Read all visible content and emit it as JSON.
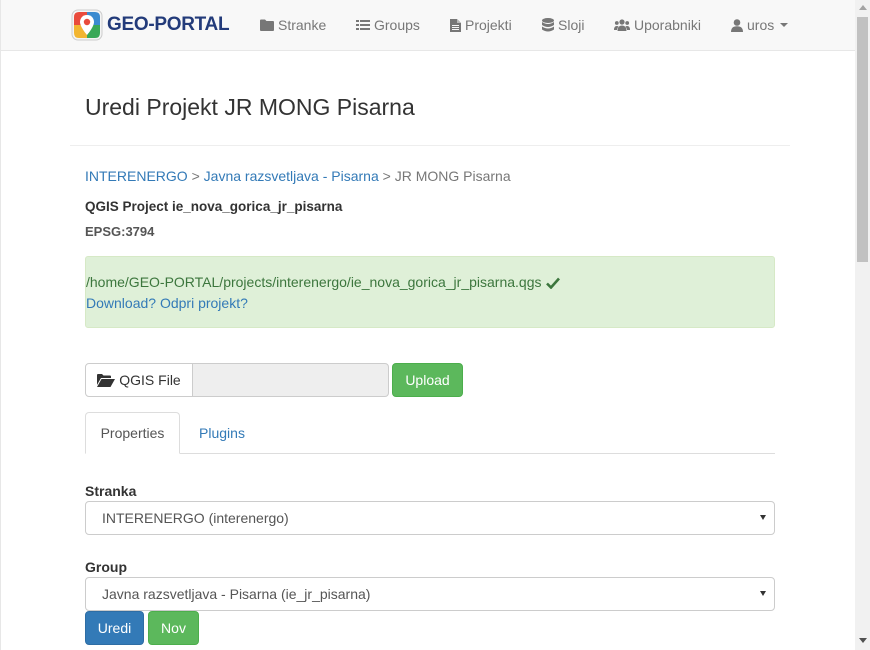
{
  "navbar": {
    "brand": "GEO-PORTAL",
    "items": [
      {
        "label": "Stranke",
        "icon": "folder-icon"
      },
      {
        "label": "Groups",
        "icon": "list-icon"
      },
      {
        "label": "Projekti",
        "icon": "file-icon"
      },
      {
        "label": "Sloji",
        "icon": "database-icon"
      },
      {
        "label": "Uporabniki",
        "icon": "users-icon"
      }
    ],
    "user": {
      "label": "uros",
      "icon": "user-icon"
    }
  },
  "page": {
    "title": "Uredi Projekt JR MONG Pisarna",
    "breadcrumb": [
      {
        "label": "INTERENERGO"
      },
      {
        "label": "Javna razsvetljava - Pisarna"
      },
      {
        "label": "JR MONG Pisarna"
      }
    ],
    "breadcrumb_separator": ">",
    "qgis_project": "QGIS Project ie_nova_gorica_jr_pisarna",
    "epsg": "EPSG:3794"
  },
  "alert": {
    "path": "/home/GEO-PORTAL/projects/interenergo/ie_nova_gorica_jr_pisarna.qgs",
    "download_link": "Download?",
    "open_link": "Odpri projekt?",
    "color": "#3c763d"
  },
  "upload": {
    "file_button": "QGIS File",
    "file_value": "",
    "upload_button": "Upload"
  },
  "tabs": [
    {
      "label": "Properties",
      "active": true
    },
    {
      "label": "Plugins",
      "active": false
    }
  ],
  "form": {
    "stranka_label": "Stranka",
    "stranka_value": "INTERENERGO (interenergo)",
    "group_label": "Group",
    "group_value": "Javna razsvetljava - Pisarna (ie_jr_pisarna)",
    "save_button": "Uredi",
    "new_button": "Nov"
  },
  "colors": {
    "primary": "#337ab7",
    "success": "#5cb85c",
    "brand": "#233b7a"
  }
}
